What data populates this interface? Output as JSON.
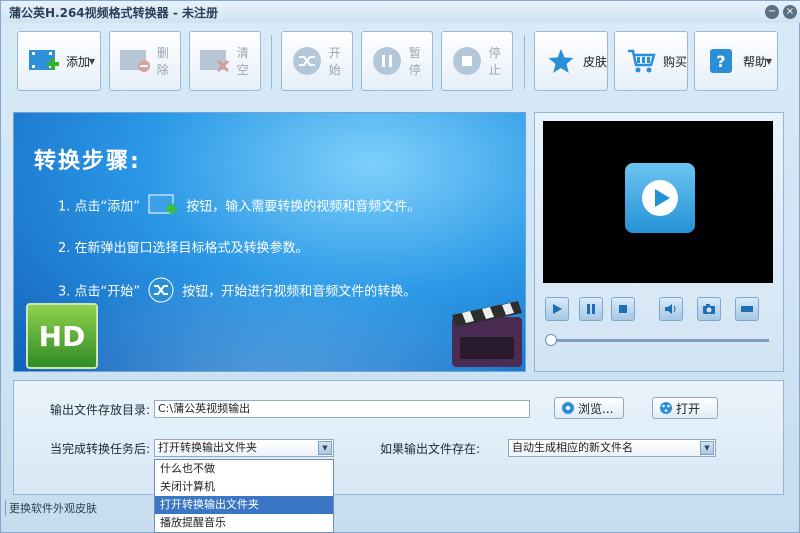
{
  "app": {
    "title": "蒲公英H.264视频格式转换器 - 未注册"
  },
  "window_controls": {
    "minimize": "−",
    "close": "×"
  },
  "toolbar": {
    "add": "添加",
    "delete": "删除",
    "clear": "清空",
    "start": "开始",
    "pause": "暂停",
    "stop": "停止",
    "skin": "皮肤",
    "buy": "购买",
    "help": "帮助"
  },
  "banner": {
    "steps_title": "转换步骤:",
    "step1_a": "1. 点击“添加”",
    "step1_b": "按钮，输入需要转换的视频和音频文件。",
    "step2": "2. 在新弹出窗口选择目标格式及转换参数。",
    "step3_a": "3. 点击“开始”",
    "step3_b": "按钮，开始进行视频和音频文件的转换。",
    "hd_badge": "HD"
  },
  "player": {
    "progress": 0
  },
  "settings": {
    "output_dir_label": "输出文件存放目录:",
    "output_dir_value": "C:\\蒲公英视频输出",
    "browse": "浏览...",
    "open": "打开",
    "after_done_label": "当完成转换任务后:",
    "after_done_value": "打开转换输出文件夹",
    "if_exists_label": "如果输出文件存在:",
    "if_exists_value": "自动生成相应的新文件名"
  },
  "after_done_options": [
    "什么也不做",
    "关闭计算机",
    "打开转换输出文件夹",
    "播放提醒音乐"
  ],
  "status": {
    "text": "更换软件外观皮肤"
  },
  "colors": {
    "accent": "#2493d6",
    "selected": "#3a76c3",
    "disabled_text": "#9aa6b2"
  }
}
